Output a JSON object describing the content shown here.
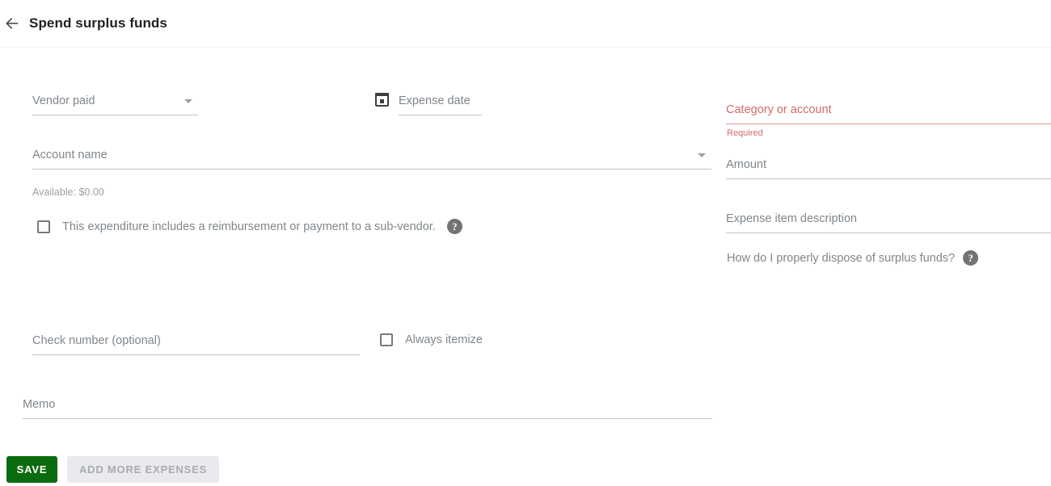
{
  "header": {
    "back_icon": "back-arrow-icon",
    "title": "Spend surplus funds"
  },
  "form": {
    "vendor_paid": {
      "label": "Vendor paid",
      "value": "",
      "icon": "chevron-down-icon"
    },
    "expense_date": {
      "label": "Expense date",
      "value": "",
      "icon": "calendar-icon"
    },
    "account_name": {
      "label": "Account name",
      "value": "",
      "icon": "chevron-down-icon"
    },
    "available": "Available: $0.00",
    "subvendor_checkbox": {
      "label": "This expenditure includes a reimbursement or payment to a sub-vendor.",
      "checked": false,
      "help_icon": "help-icon",
      "help_glyph": "?"
    },
    "check_number": {
      "label": "Check number (optional)",
      "value": ""
    },
    "always_itemize": {
      "label": "Always itemize",
      "checked": false
    },
    "memo": {
      "label": "Memo",
      "value": ""
    },
    "category_or_account": {
      "label": "Category or account",
      "value": "",
      "error": "Required",
      "error_color": "#d46a6a"
    },
    "amount": {
      "label": "Amount",
      "value": ""
    },
    "expense_item_description": {
      "label": "Expense item description",
      "value": ""
    },
    "surplus_help": {
      "text": "How do I properly dispose of surplus funds?",
      "help_icon": "help-icon",
      "help_glyph": "?"
    }
  },
  "actions": {
    "save_label": "SAVE",
    "save_color": "#0b6b0f",
    "add_more_label": "ADD MORE EXPENSES",
    "add_more_disabled": true
  }
}
